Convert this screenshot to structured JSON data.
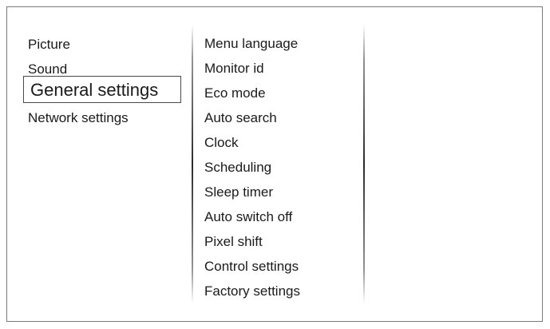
{
  "main_menu": {
    "items": [
      {
        "label": "Picture"
      },
      {
        "label": "Sound"
      },
      {
        "label": "General settings"
      },
      {
        "label": "Network settings"
      }
    ]
  },
  "submenu": {
    "items": [
      {
        "label": "Menu language"
      },
      {
        "label": "Monitor id"
      },
      {
        "label": "Eco mode"
      },
      {
        "label": "Auto search"
      },
      {
        "label": "Clock"
      },
      {
        "label": "Scheduling"
      },
      {
        "label": "Sleep timer"
      },
      {
        "label": "Auto switch off"
      },
      {
        "label": "Pixel shift"
      },
      {
        "label": "Control settings"
      },
      {
        "label": "Factory settings"
      }
    ]
  }
}
